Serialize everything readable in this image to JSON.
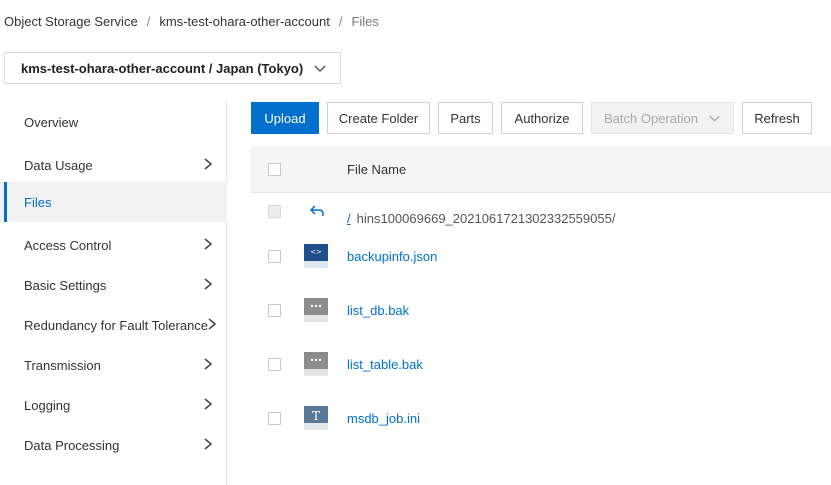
{
  "breadcrumb": {
    "items": [
      "Object Storage Service",
      "kms-test-ohara-other-account",
      "Files"
    ],
    "separator": "/"
  },
  "bucket_selector": {
    "value": "kms-test-ohara-other-account / Japan (Tokyo)",
    "icon": "chevron-down-icon"
  },
  "sidebar": {
    "items": [
      {
        "label": "Overview",
        "has_children": false,
        "active": false
      },
      {
        "label": "Data Usage",
        "has_children": true,
        "active": false
      },
      {
        "label": "Files",
        "has_children": false,
        "active": true
      },
      {
        "label": "Access Control",
        "has_children": true,
        "active": false
      },
      {
        "label": "Basic Settings",
        "has_children": true,
        "active": false
      },
      {
        "label": "Redundancy for Fault Tolerance",
        "has_children": true,
        "active": false
      },
      {
        "label": "Transmission",
        "has_children": true,
        "active": false
      },
      {
        "label": "Logging",
        "has_children": true,
        "active": false
      },
      {
        "label": "Data Processing",
        "has_children": true,
        "active": false
      }
    ]
  },
  "toolbar": {
    "upload": "Upload",
    "create_folder": "Create Folder",
    "parts": "Parts",
    "authorize": "Authorize",
    "batch_operation": "Batch Operation",
    "refresh": "Refresh"
  },
  "table": {
    "column_file_name": "File Name",
    "back_row": {
      "up_link": "/",
      "path": "hins100069669_20210617213023325590​55/"
    },
    "files": [
      {
        "name": "backupinfo.json",
        "icon": "json-file-icon"
      },
      {
        "name": "list_db.bak",
        "icon": "generic-file-icon"
      },
      {
        "name": "list_table.bak",
        "icon": "generic-file-icon"
      },
      {
        "name": "msdb_job.ini",
        "icon": "text-file-icon"
      }
    ]
  },
  "colors": {
    "accent": "#0070cc",
    "json_icon": "#1f4e8c",
    "generic_icon": "#8c8c8c",
    "text_icon": "#5b7a99"
  }
}
